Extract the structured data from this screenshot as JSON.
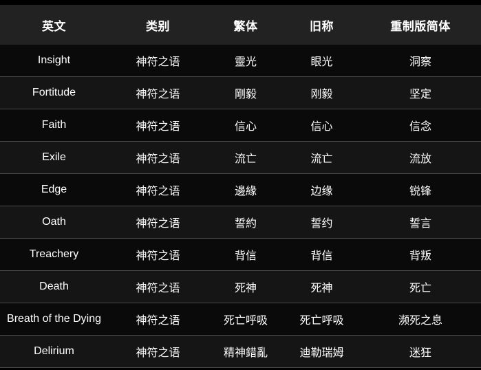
{
  "table": {
    "columns": [
      {
        "key": "english",
        "label": "英文"
      },
      {
        "key": "category",
        "label": "类别"
      },
      {
        "key": "trad",
        "label": "繁体"
      },
      {
        "key": "old",
        "label": "旧称"
      },
      {
        "key": "remaster",
        "label": "重制版简体"
      }
    ],
    "rows": [
      {
        "english": "Insight",
        "category": "神符之语",
        "trad": "靈光",
        "old": "眼光",
        "remaster": "洞察"
      },
      {
        "english": "Fortitude",
        "category": "神符之语",
        "trad": "剛毅",
        "old": "刚毅",
        "remaster": "坚定"
      },
      {
        "english": "Faith",
        "category": "神符之语",
        "trad": "信心",
        "old": "信心",
        "remaster": "信念"
      },
      {
        "english": "Exile",
        "category": "神符之语",
        "trad": "流亡",
        "old": "流亡",
        "remaster": "流放"
      },
      {
        "english": "Edge",
        "category": "神符之语",
        "trad": "邊緣",
        "old": "边缘",
        "remaster": "锐锋"
      },
      {
        "english": "Oath",
        "category": "神符之语",
        "trad": "誓約",
        "old": "誓约",
        "remaster": "誓言"
      },
      {
        "english": "Treachery",
        "category": "神符之语",
        "trad": "背信",
        "old": "背信",
        "remaster": "背叛"
      },
      {
        "english": "Death",
        "category": "神符之语",
        "trad": "死神",
        "old": "死神",
        "remaster": "死亡"
      },
      {
        "english": "Breath of the Dying",
        "category": "神符之语",
        "trad": "死亡呼吸",
        "old": "死亡呼吸",
        "remaster": "濒死之息"
      },
      {
        "english": "Delirium",
        "category": "神符之语",
        "trad": "精神錯亂",
        "old": "迪勒瑞姆",
        "remaster": "迷狂"
      }
    ]
  },
  "colors": {
    "page_background": "#000000",
    "header_background": "#222222",
    "row_odd_background": "#0a0a0a",
    "row_even_background": "#151515",
    "row_separator": "#4a4a4a",
    "text": "#ffffff"
  }
}
